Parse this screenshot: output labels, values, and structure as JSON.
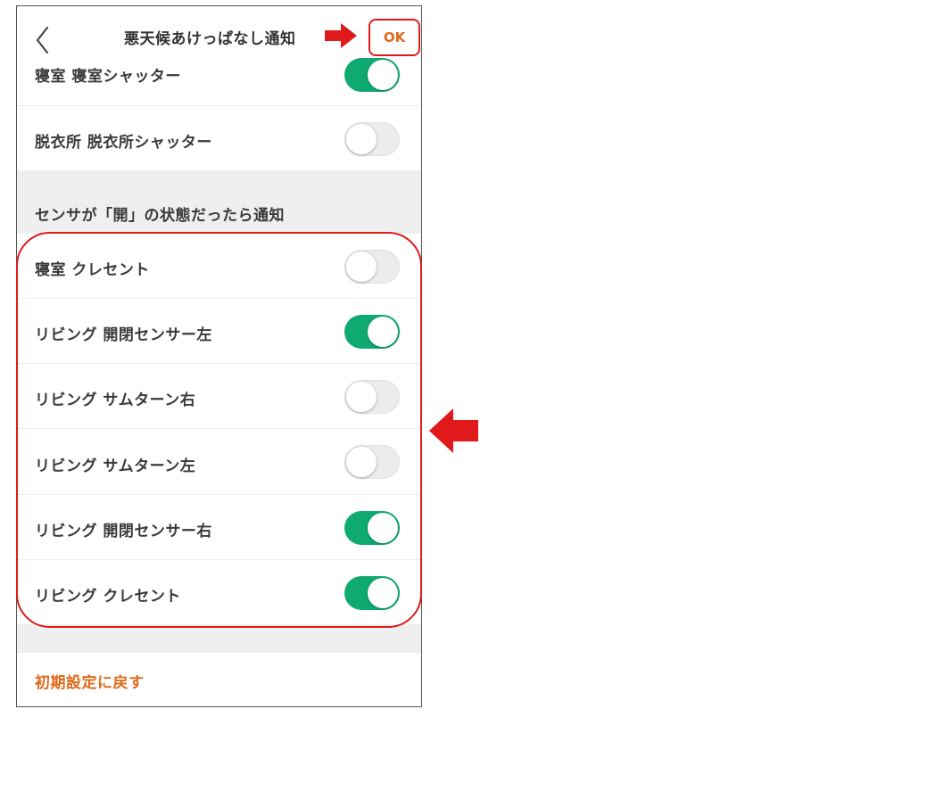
{
  "header": {
    "title": "悪天候あけっぱなし通知",
    "ok_label": "OK"
  },
  "shutter_rows": [
    {
      "label": "寝室 寝室シャッター",
      "on": true
    },
    {
      "label": "脱衣所 脱衣所シャッター",
      "on": false
    }
  ],
  "sensor_section": {
    "title": "センサが「開」の状態だったら通知",
    "rows": [
      {
        "label": "寝室 クレセント",
        "on": false
      },
      {
        "label": "リビング 開閉センサー左",
        "on": true
      },
      {
        "label": "リビング サムターン右",
        "on": false
      },
      {
        "label": "リビング サムターン左",
        "on": false
      },
      {
        "label": "リビング 開閉センサー右",
        "on": true
      },
      {
        "label": "リビング クレセント",
        "on": true
      }
    ]
  },
  "footer": {
    "reset_label": "初期設定に戻す"
  },
  "colors": {
    "toggle_on": "#0faa72",
    "accent_orange": "#e06a1a",
    "annotation_red": "#e01a1a"
  }
}
